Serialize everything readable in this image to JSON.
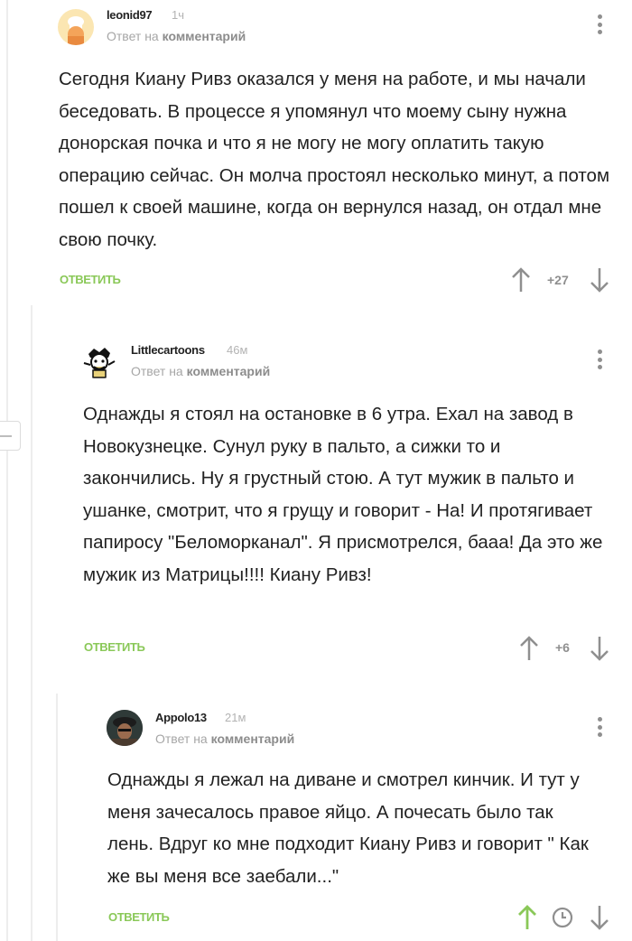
{
  "colors": {
    "accent_green": "#8ac858",
    "text": "#222222",
    "muted": "#a6a6a6"
  },
  "comments": [
    {
      "author": "leonid97",
      "time": "1ч",
      "reply_prefix": "Ответ на",
      "reply_link": "комментарий",
      "text": "Сегодня Киану Ривз оказался у меня на работе, и мы начали беседовать. В процессе я упомянул что моему сыну нужна донорская почка и что я не могу не могу оплатить такую операцию сейчас. Он молча простоял несколько минут, а потом пошел к своей машине, когда он вернулся назад, он отдал мне свою почку.",
      "reply_label": "ОТВЕТИТЬ",
      "rating": "+27",
      "avatar_icon": "chef-avatar-icon"
    },
    {
      "author": "Littlecartoons",
      "time": "46м",
      "reply_prefix": "Ответ на",
      "reply_link": "комментарий",
      "text": "Однажды я стоял на остановке в 6 утра. Ехал на завод в Новокузнецке. Сунул руку в пальто, а сижки то и закончились. Ну я грустный стою. А тут мужик в пальто и ушанке, смотрит, что я грущу и говорит - На! И протягивает папиросу \"Беломорканал\". Я присмотрелся, бааа! Да это же мужик из Матрицы!!!! Киану Ривз!",
      "reply_label": "ОТВЕТИТЬ",
      "rating": "+6",
      "avatar_icon": "cartoon-avatar-icon"
    },
    {
      "author": "Appolo13",
      "time": "21м",
      "reply_prefix": "Ответ на",
      "reply_link": "комментарий",
      "text": "Однажды я лежал на диване и смотрел кинчик. И тут у меня зачесалось правое яйцо. А почесать было так лень. Вдруг ко мне подходит Киану Ривз и говорит \" Как же вы меня все заебали...\"",
      "reply_label": "ОТВЕТИТЬ",
      "avatar_icon": "photo-avatar-icon"
    }
  ]
}
